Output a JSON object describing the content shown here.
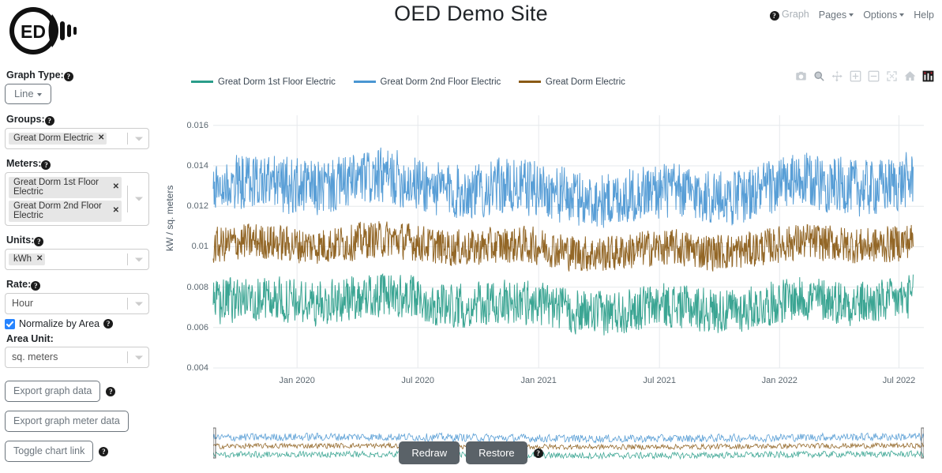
{
  "header": {
    "title": "OED Demo Site",
    "logo_text": "ED",
    "logo_name": "oed-lightbulb-logo",
    "nav": [
      {
        "label": "Graph",
        "icon": "help-icon",
        "muted": true,
        "caret": false
      },
      {
        "label": "Pages",
        "icon": "",
        "muted": false,
        "caret": true
      },
      {
        "label": "Options",
        "icon": "",
        "muted": false,
        "caret": true
      },
      {
        "label": "Help",
        "icon": "",
        "muted": false,
        "caret": false
      }
    ]
  },
  "sidebar": {
    "graph_type": {
      "label": "Graph Type:",
      "value": "Line"
    },
    "groups": {
      "label": "Groups:",
      "chips": [
        "Great Dorm Electric"
      ]
    },
    "meters": {
      "label": "Meters:",
      "chips": [
        "Great Dorm 1st Floor Electric",
        "Great Dorm 2nd Floor Electric"
      ]
    },
    "units": {
      "label": "Units:",
      "chips": [
        "kWh"
      ]
    },
    "rate": {
      "label": "Rate:",
      "value": "Hour"
    },
    "normalize": {
      "label": "Normalize by Area",
      "checked": true
    },
    "area_unit": {
      "label": "Area Unit:",
      "value": "sq. meters"
    },
    "buttons": [
      {
        "label": "Export graph data",
        "help": true
      },
      {
        "label": "Export graph meter data",
        "help": false
      },
      {
        "label": "Toggle chart link",
        "help": true
      }
    ]
  },
  "chart": {
    "modebar": [
      "camera-icon",
      "zoom-icon",
      "pan-icon",
      "zoom-in-icon",
      "zoom-out-icon",
      "autoscale-icon",
      "reset-home-icon",
      "toggle-spikelines-icon"
    ]
  },
  "footer": {
    "redraw_label": "Redraw",
    "restore_label": "Restore",
    "help": true
  },
  "chart_data": {
    "type": "line",
    "title": "",
    "xlabel": "",
    "ylabel": "kW / sq. meters",
    "ylim": [
      0.004,
      0.0165
    ],
    "yticks": [
      0.004,
      0.006,
      0.008,
      0.01,
      0.012,
      0.014,
      0.016
    ],
    "ytick_labels": [
      "0.004",
      "0.006",
      "0.008",
      "0.01",
      "0.012",
      "0.014",
      "0.016"
    ],
    "xticks": [
      "Jan 2020",
      "Jul 2020",
      "Jan 2021",
      "Jul 2021",
      "Jan 2022",
      "Jul 2022"
    ],
    "xtick_positions": [
      0.118,
      0.288,
      0.458,
      0.628,
      0.797,
      0.965
    ],
    "xrange": [
      "Sep 2019",
      "Nov 2022"
    ],
    "grid": true,
    "legend_position": "top-left",
    "rangeslider": true,
    "series": [
      {
        "name": "Great Dorm 1st Floor Electric",
        "color": "#2a9d8a",
        "mean": 0.00715,
        "min": 0.0048,
        "max": 0.0098,
        "noise": 0.00115
      },
      {
        "name": "Great Dorm 2nd Floor Electric",
        "color": "#4a96d2",
        "mean": 0.01285,
        "min": 0.0099,
        "max": 0.0163,
        "noise": 0.00145
      },
      {
        "name": "Great Dorm Electric",
        "color": "#8a5a15",
        "mean": 0.01,
        "min": 0.0077,
        "max": 0.0124,
        "noise": 0.00095
      }
    ]
  }
}
